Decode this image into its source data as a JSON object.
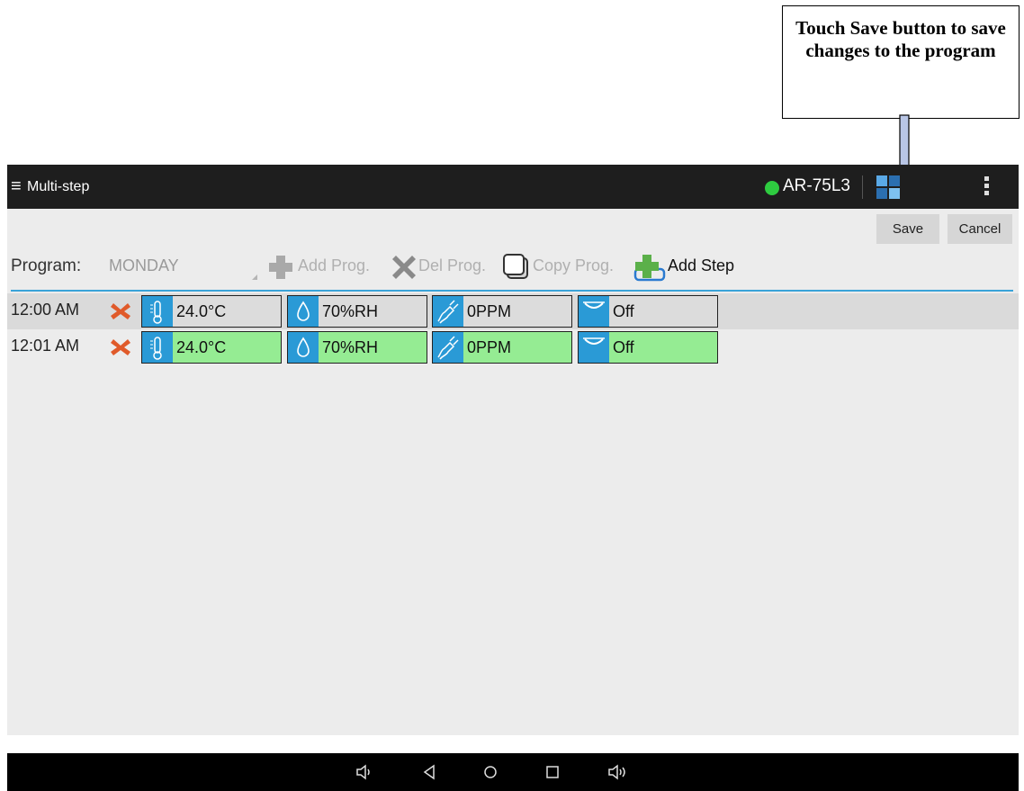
{
  "callout": {
    "text": "Touch Save button to save changes to the program"
  },
  "app": {
    "title": "Multi-step",
    "device_name": "AR-75L3",
    "status_color": "#2ecc40",
    "accent_color": "#2a9ad6"
  },
  "actions": {
    "save_label": "Save",
    "cancel_label": "Cancel"
  },
  "program": {
    "label": "Program:",
    "selected": "MONDAY",
    "tools": {
      "add_prog": "Add Prog.",
      "del_prog": "Del Prog.",
      "copy_prog": "Copy Prog.",
      "add_step": "Add Step"
    }
  },
  "steps": [
    {
      "time": "12:00 AM",
      "temperature": "24.0°C",
      "humidity": "70%RH",
      "co2": "0PPM",
      "light": "Off",
      "state": "saved"
    },
    {
      "time": "12:01 AM",
      "temperature": "24.0°C",
      "humidity": "70%RH",
      "co2": "0PPM",
      "light": "Off",
      "state": "modified"
    }
  ],
  "icons": [
    "menu-icon",
    "status-dot-icon",
    "grid-icon",
    "overflow-menu-icon",
    "plus-icon",
    "x-icon",
    "copy-icon",
    "add-step-icon",
    "delete-step-icon",
    "thermometer-icon",
    "droplet-icon",
    "co2-plug-icon",
    "light-icon",
    "volume-down-icon",
    "back-icon",
    "home-icon",
    "recents-icon",
    "volume-up-icon"
  ]
}
